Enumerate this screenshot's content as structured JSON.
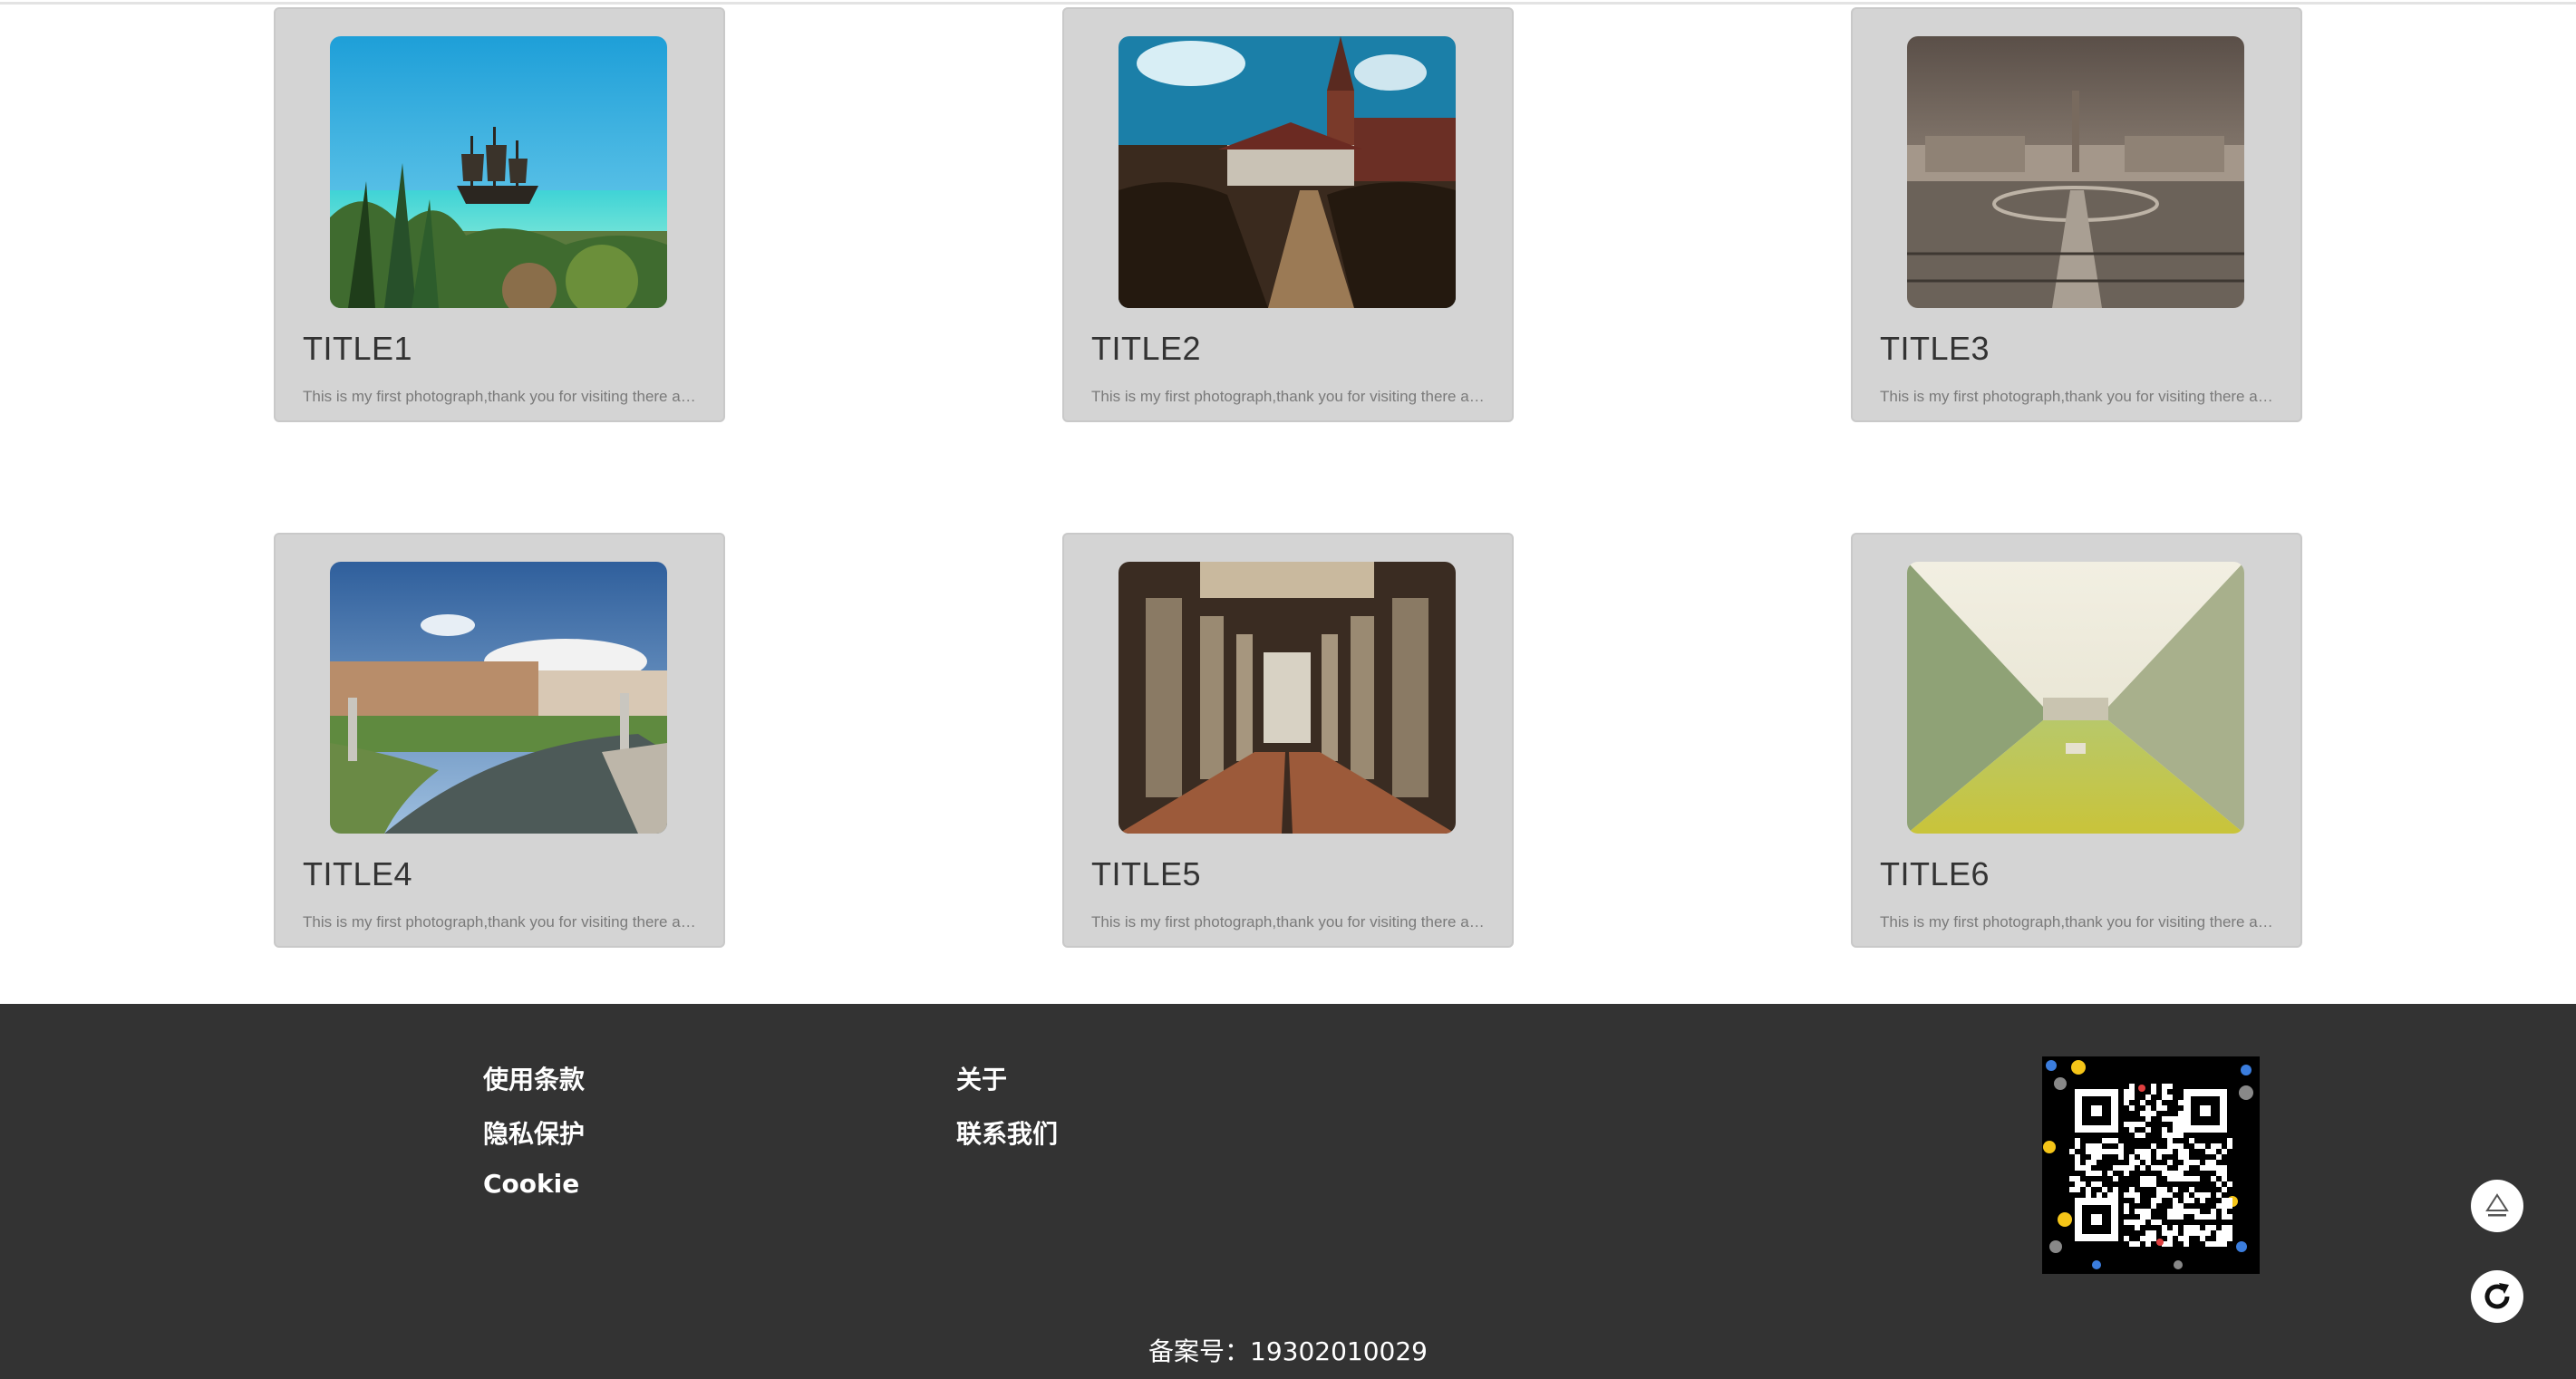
{
  "gallery": {
    "cards": [
      {
        "title": "TITLE1",
        "description": "This is my first photograph,thank you for visiting there and enjoy",
        "image": "pirate-ship-beach-photo"
      },
      {
        "title": "TITLE2",
        "description": "This is my first photograph,thank you for visiting there and enjoy",
        "image": "church-garden-path-photo"
      },
      {
        "title": "TITLE3",
        "description": "This is my first photograph,thank you for visiting there and enjoy",
        "image": "st-peters-square-photo"
      },
      {
        "title": "TITLE4",
        "description": "This is my first photograph,thank you for visiting there and enjoy",
        "image": "canal-statues-photo"
      },
      {
        "title": "TITLE5",
        "description": "This is my first photograph,thank you for visiting there and enjoy",
        "image": "basilica-interior-photo"
      },
      {
        "title": "TITLE6",
        "description": "This is my first photograph,thank you for visiting there and enjoy",
        "image": "cloister-lawn-photo"
      }
    ]
  },
  "footer": {
    "links_col1": [
      "使用条款",
      "隐私保护",
      "Cookie"
    ],
    "links_col2": [
      "关于",
      "联系我们"
    ],
    "qr_icon": "qr-code",
    "record": "备案号：19302010029"
  },
  "floating": {
    "top_icon": "back-to-top-icon",
    "refresh_icon": "refresh-icon"
  },
  "colors": {
    "card_bg": "#d4d4d4",
    "footer_bg": "#333333",
    "title": "#333333",
    "desc": "#7a7a7a"
  }
}
